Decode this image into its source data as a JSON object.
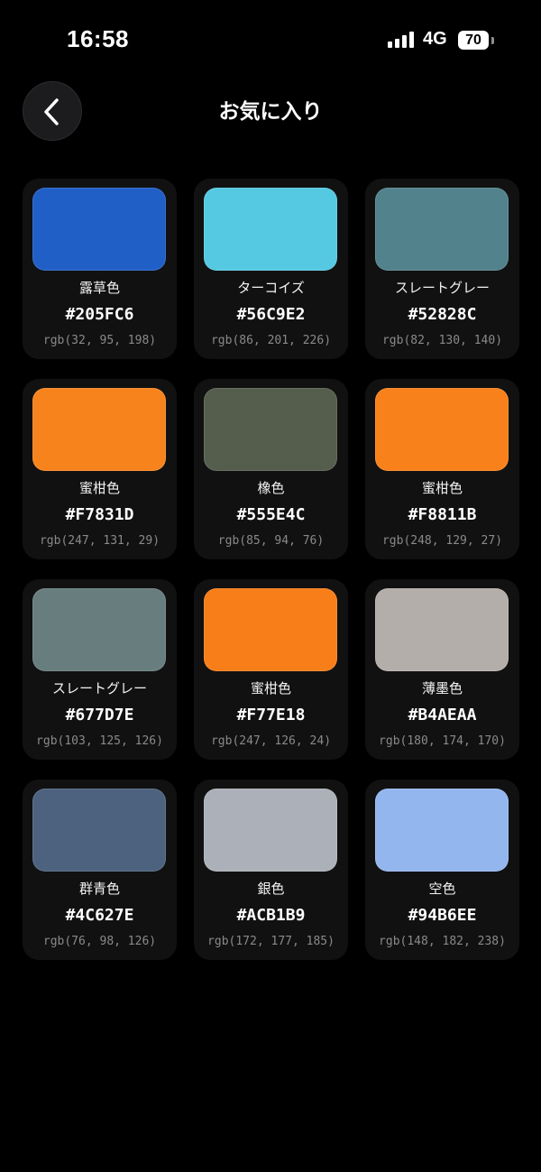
{
  "status_bar": {
    "time": "16:58",
    "network": "4G",
    "battery": "70",
    "icons": [
      "signal-icon",
      "battery-icon"
    ]
  },
  "header": {
    "title": "お気に入り",
    "back_icon": "chevron-left-icon"
  },
  "favorites": [
    {
      "name": "露草色",
      "hex": "#205FC6",
      "rgb": "rgb(32, 95, 198)",
      "color": "#205FC6"
    },
    {
      "name": "ターコイズ",
      "hex": "#56C9E2",
      "rgb": "rgb(86, 201, 226)",
      "color": "#56C9E2"
    },
    {
      "name": "スレートグレー",
      "hex": "#52828C",
      "rgb": "rgb(82, 130, 140)",
      "color": "#52828C"
    },
    {
      "name": "蜜柑色",
      "hex": "#F7831D",
      "rgb": "rgb(247, 131, 29)",
      "color": "#F7831D"
    },
    {
      "name": "橡色",
      "hex": "#555E4C",
      "rgb": "rgb(85, 94, 76)",
      "color": "#555E4C"
    },
    {
      "name": "蜜柑色",
      "hex": "#F8811B",
      "rgb": "rgb(248, 129, 27)",
      "color": "#F8811B"
    },
    {
      "name": "スレートグレー",
      "hex": "#677D7E",
      "rgb": "rgb(103, 125, 126)",
      "color": "#677D7E"
    },
    {
      "name": "蜜柑色",
      "hex": "#F77E18",
      "rgb": "rgb(247, 126, 24)",
      "color": "#F77E18"
    },
    {
      "name": "薄墨色",
      "hex": "#B4AEAA",
      "rgb": "rgb(180, 174, 170)",
      "color": "#B4AEAA"
    },
    {
      "name": "群青色",
      "hex": "#4C627E",
      "rgb": "rgb(76, 98, 126)",
      "color": "#4C627E"
    },
    {
      "name": "銀色",
      "hex": "#ACB1B9",
      "rgb": "rgb(172, 177, 185)",
      "color": "#ACB1B9"
    },
    {
      "name": "空色",
      "hex": "#94B6EE",
      "rgb": "rgb(148, 182, 238)",
      "color": "#94B6EE"
    }
  ]
}
